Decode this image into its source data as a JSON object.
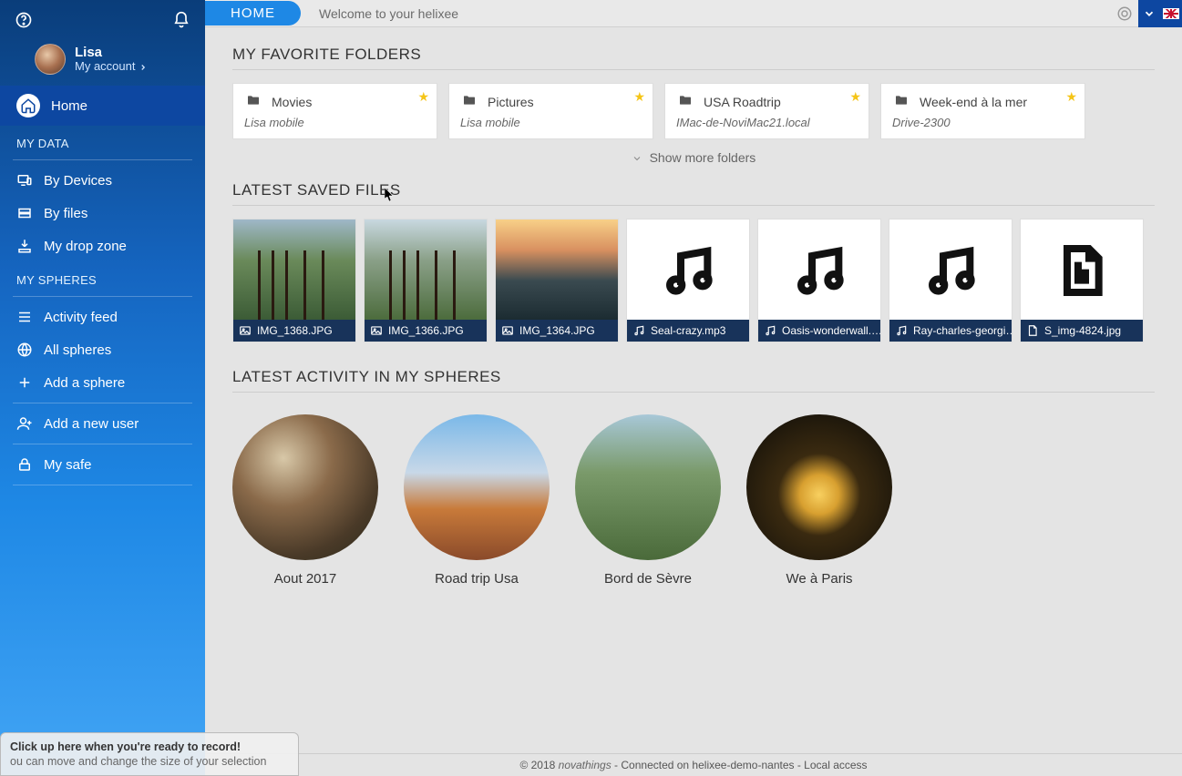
{
  "sidebar": {
    "username": "Lisa",
    "account_label": "My account",
    "nav_home": "Home",
    "section_mydata": "MY DATA",
    "nav_devices": "By Devices",
    "nav_files": "By files",
    "nav_dropzone": "My drop zone",
    "section_spheres": "MY SPHERES",
    "nav_activity": "Activity feed",
    "nav_allspheres": "All spheres",
    "nav_addsphere": "Add a sphere",
    "nav_adduser": "Add a new user",
    "nav_safe": "My safe"
  },
  "header": {
    "tab_home": "HOME",
    "welcome": "Welcome to your helixee"
  },
  "favorites": {
    "title": "MY FAVORITE FOLDERS",
    "show_more": "Show more folders",
    "items": [
      {
        "name": "Movies",
        "source": "Lisa mobile"
      },
      {
        "name": "Pictures",
        "source": "Lisa mobile"
      },
      {
        "name": "USA Roadtrip",
        "source": "IMac-de-NoviMac21.local"
      },
      {
        "name": "Week-end à la mer",
        "source": "Drive-2300"
      }
    ]
  },
  "latest_files": {
    "title": "LATEST SAVED FILES",
    "items": [
      {
        "name": "IMG_1368.JPG",
        "type": "image"
      },
      {
        "name": "IMG_1366.JPG",
        "type": "image"
      },
      {
        "name": "IMG_1364.JPG",
        "type": "image"
      },
      {
        "name": "Seal-crazy.mp3",
        "type": "audio"
      },
      {
        "name": "Oasis-wonderwall.…",
        "type": "audio"
      },
      {
        "name": "Ray-charles-georgi…",
        "type": "audio"
      },
      {
        "name": "S_img-4824.jpg",
        "type": "doc"
      }
    ]
  },
  "latest_spheres": {
    "title": "LATEST ACTIVITY IN MY SPHERES",
    "items": [
      {
        "name": "Aout 2017"
      },
      {
        "name": "Road trip Usa"
      },
      {
        "name": "Bord de Sèvre"
      },
      {
        "name": "We à Paris"
      }
    ]
  },
  "footer": {
    "copyright": "© 2018",
    "brand": "novathings",
    "status": "- Connected on helixee-demo-nantes - Local access"
  },
  "overlay": {
    "line1": "Click up here when you're ready to record!",
    "line2": "ou can move and change the size of your selection"
  }
}
